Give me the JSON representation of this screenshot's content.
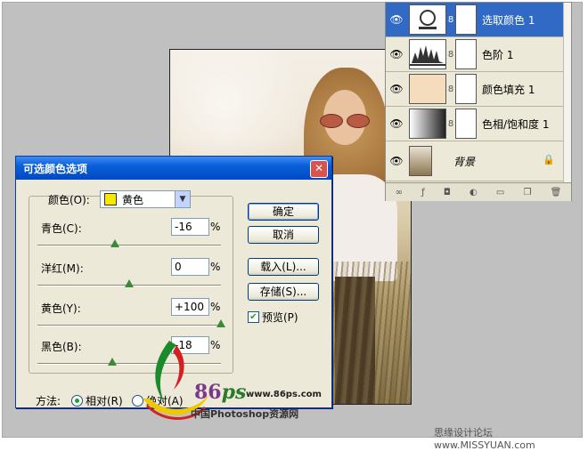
{
  "layers_panel": {
    "layers": [
      {
        "name": "选取颜色 1",
        "visible": true,
        "selected": true,
        "thumb": "adjustment-icon"
      },
      {
        "name": "色阶 1",
        "visible": true,
        "selected": false,
        "thumb": "histogram-icon"
      },
      {
        "name": "颜色填充 1",
        "visible": true,
        "selected": false,
        "thumb": "fill-swatch"
      },
      {
        "name": "色相/饱和度 1",
        "visible": true,
        "selected": false,
        "thumb": "gradient-icon"
      },
      {
        "name": "背景",
        "visible": true,
        "selected": false,
        "thumb": "photo-thumb",
        "locked": true
      }
    ],
    "fill_color": "#f5dcbc",
    "selected_color": "#316ac5"
  },
  "dialog": {
    "title": "可选颜色选项",
    "close_label": "✕",
    "colors_label": "颜色(O):",
    "colors_value": "黄色",
    "colors_swatch": "#f7e800",
    "sliders": [
      {
        "label": "青色(C):",
        "value": "-16",
        "unit": "%",
        "level": -16
      },
      {
        "label": "洋红(M):",
        "value": "0",
        "unit": "%",
        "level": 0
      },
      {
        "label": "黄色(Y):",
        "value": "+100",
        "unit": "%",
        "level": 100
      },
      {
        "label": "黑色(B):",
        "value": "-18",
        "unit": "%",
        "level": -18
      }
    ],
    "buttons": {
      "ok": "确定",
      "cancel": "取消",
      "load": "载入(L)...",
      "save": "存储(S)..."
    },
    "preview_label": "预览(P)",
    "preview_checked": true,
    "method_label": "方法:",
    "relative_label": "相对(R)",
    "absolute_label": "绝对(A)",
    "method_selected": "relative"
  },
  "watermarks": {
    "brand_number": "86",
    "brand_letter": "ps",
    "site_url": "www.86ps.com",
    "site_name": "中国Photoshop资源网",
    "footer": "思缘设计论坛  www.MISSYUAN.com"
  }
}
